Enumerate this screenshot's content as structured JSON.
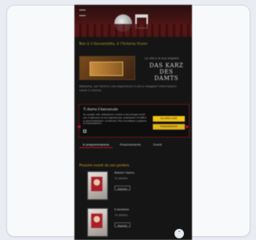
{
  "hero": {
    "menu_icon": "menu-icon"
  },
  "promo": {
    "line": "Non è il Sessantotto, è l'Antonia Vision"
  },
  "ad": {
    "top_text": "La vita e le sue stagioni",
    "title_line1": "DAS KARZ",
    "title_line2": "DES DAMTS"
  },
  "body": {
    "text": "Abbiamo, per fornirvi una esperienza in più e maggiori informazioni come il cinema."
  },
  "cookie_dialog": {
    "title": "Ti diamo il benvenuto",
    "text": "Su questo sito utilizziamo cookie e tecnologie simili per migliorare la tua esperienza, analizzare il traffico e personalizzare i contenuti. Puoi accettare o gestire le impostazioni.",
    "accept_label": "Accetta tutti",
    "settings_label": "Impostazioni",
    "checkbox_checked": false
  },
  "tabs": [
    {
      "label": "In programmazione"
    },
    {
      "label": "Prossimamente"
    },
    {
      "label": "Eventi"
    }
  ],
  "section": {
    "title": "Prossimi eventi da non perdere"
  },
  "events": [
    {
      "title": "Rossini Opera",
      "date": "12 ottobre",
      "button": "Biglietti"
    },
    {
      "title": "Il barbiere",
      "date": "19 ottobre",
      "button": "Biglietti"
    }
  ],
  "colors": {
    "accent_gold": "#c9a227",
    "accent_red": "#b5162b",
    "button_yellow": "#f0c419"
  }
}
